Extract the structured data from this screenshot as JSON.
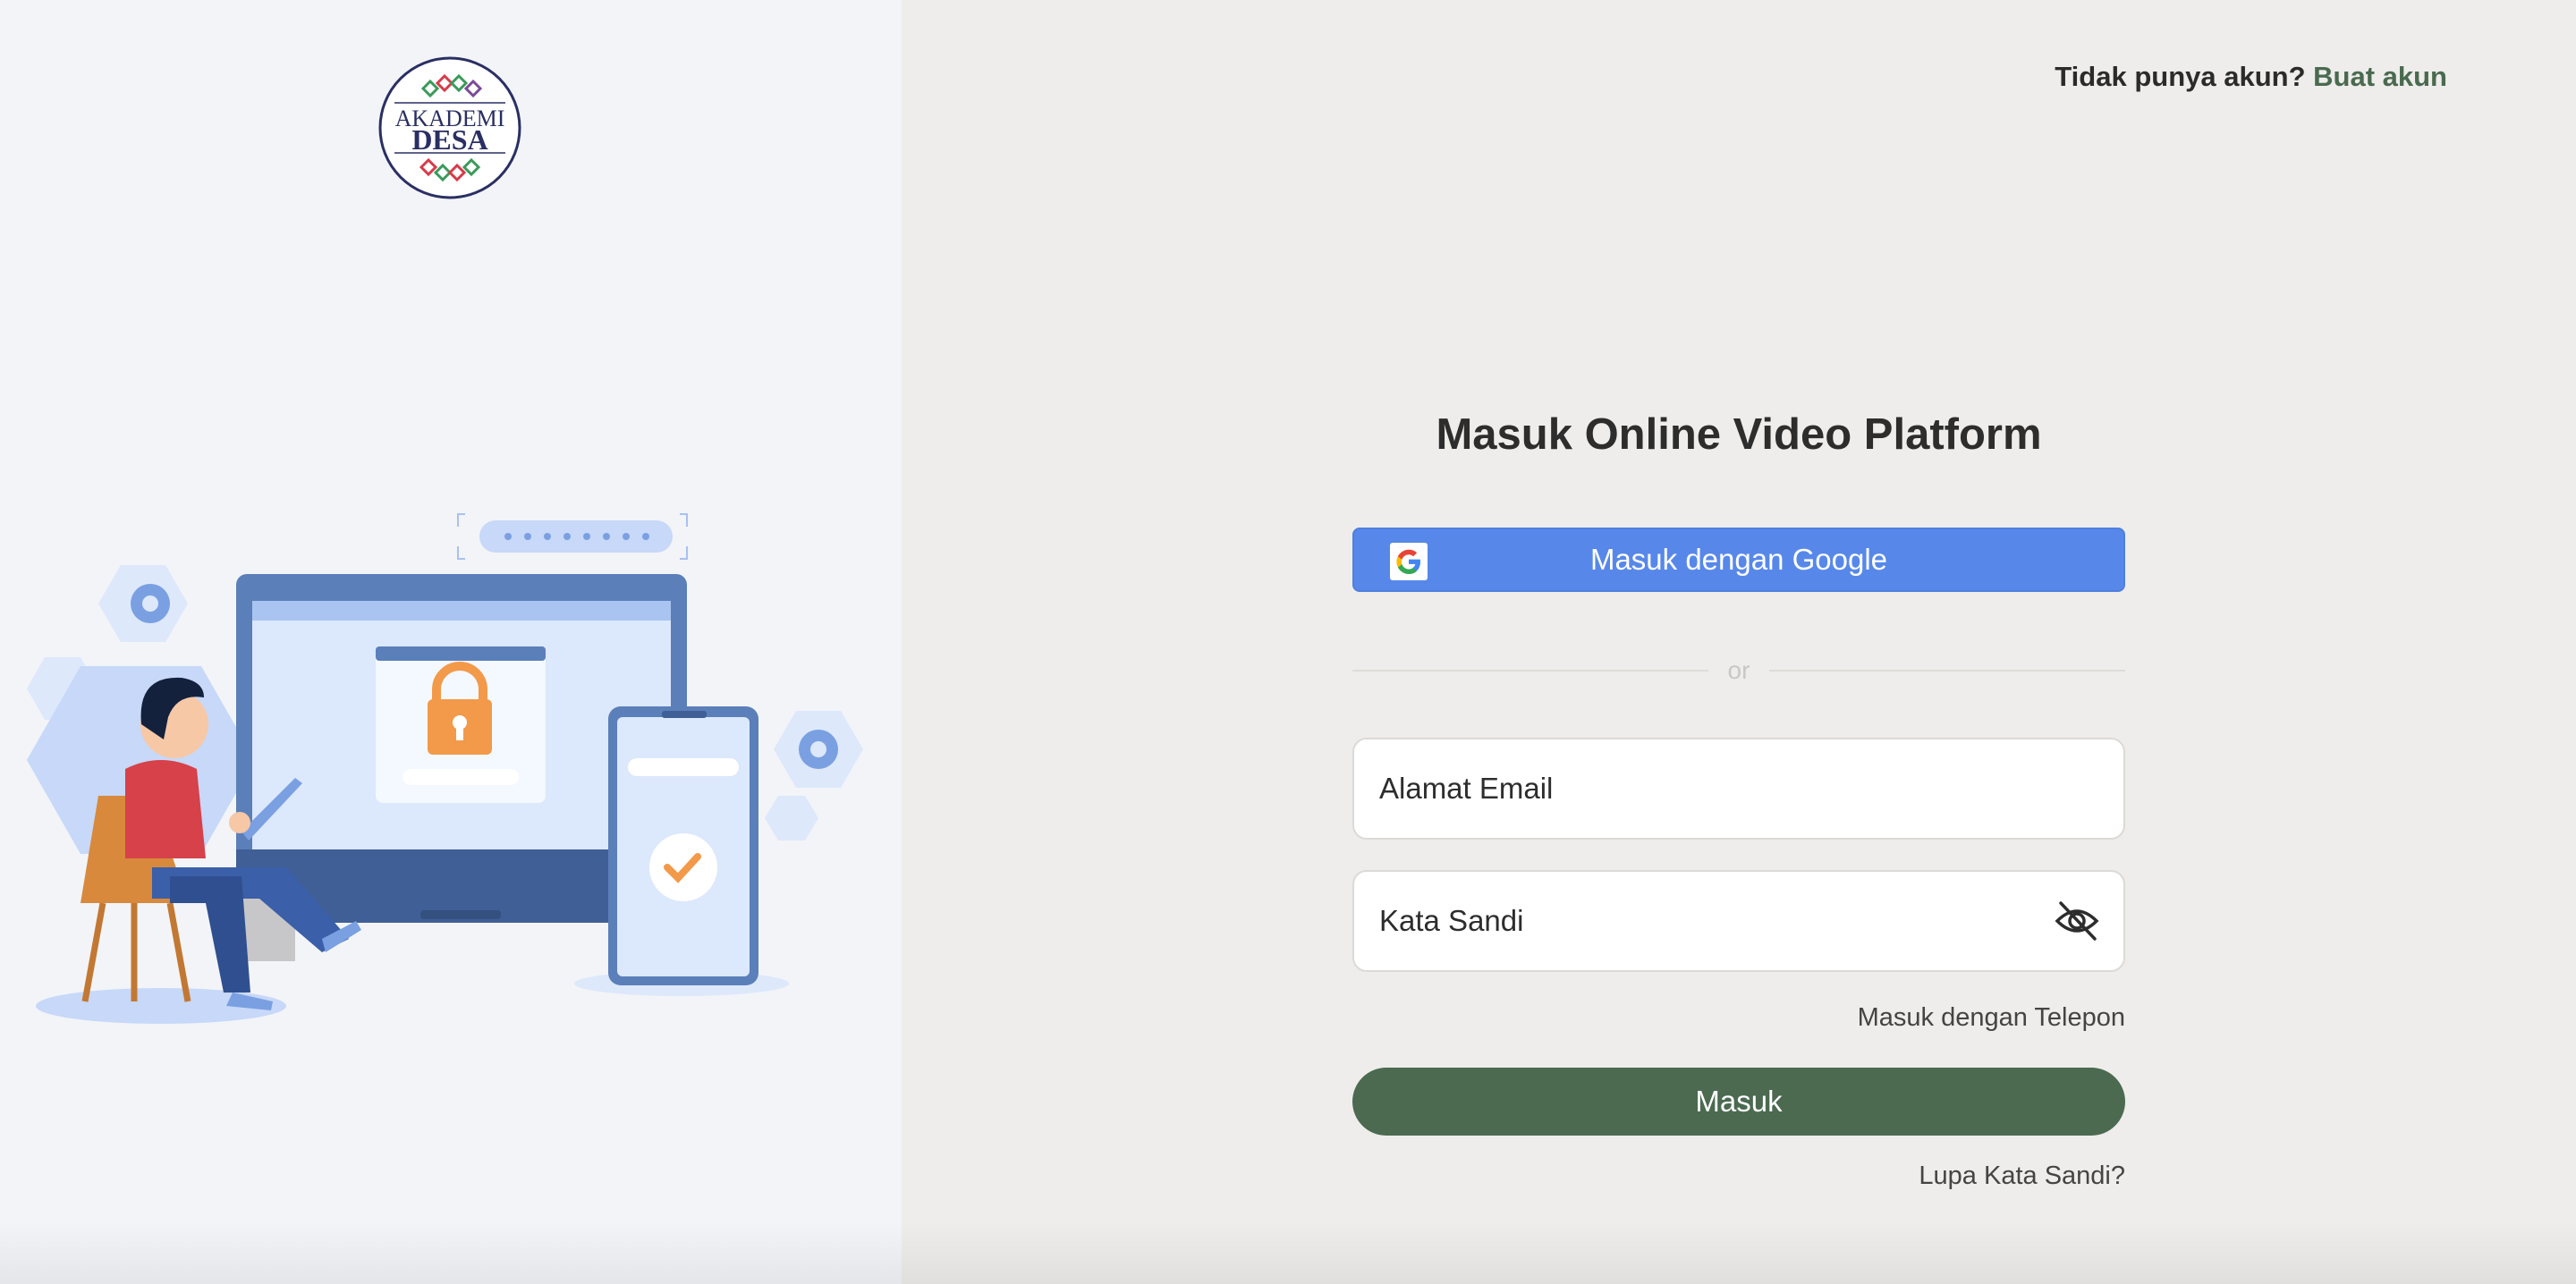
{
  "brand": {
    "logo_line1": "AKADEMI",
    "logo_line2": "DESA"
  },
  "header": {
    "signup_prompt": "Tidak punya akun?",
    "signup_link": "Buat akun"
  },
  "form": {
    "title": "Masuk Online Video Platform",
    "google_label": "Masuk dengan Google",
    "divider_text": "or",
    "email_placeholder": "Alamat Email",
    "password_placeholder": "Kata Sandi",
    "phone_login_link": "Masuk dengan Telepon",
    "submit_label": "Masuk",
    "forgot_link": "Lupa Kata Sandi?"
  },
  "icons": {
    "google": "google-icon",
    "password_toggle": "eye-off-icon"
  },
  "colors": {
    "accent_green": "#4b6a50",
    "google_blue": "#5788e9",
    "left_bg": "#f2f4f8",
    "right_bg": "#eeedeb"
  }
}
